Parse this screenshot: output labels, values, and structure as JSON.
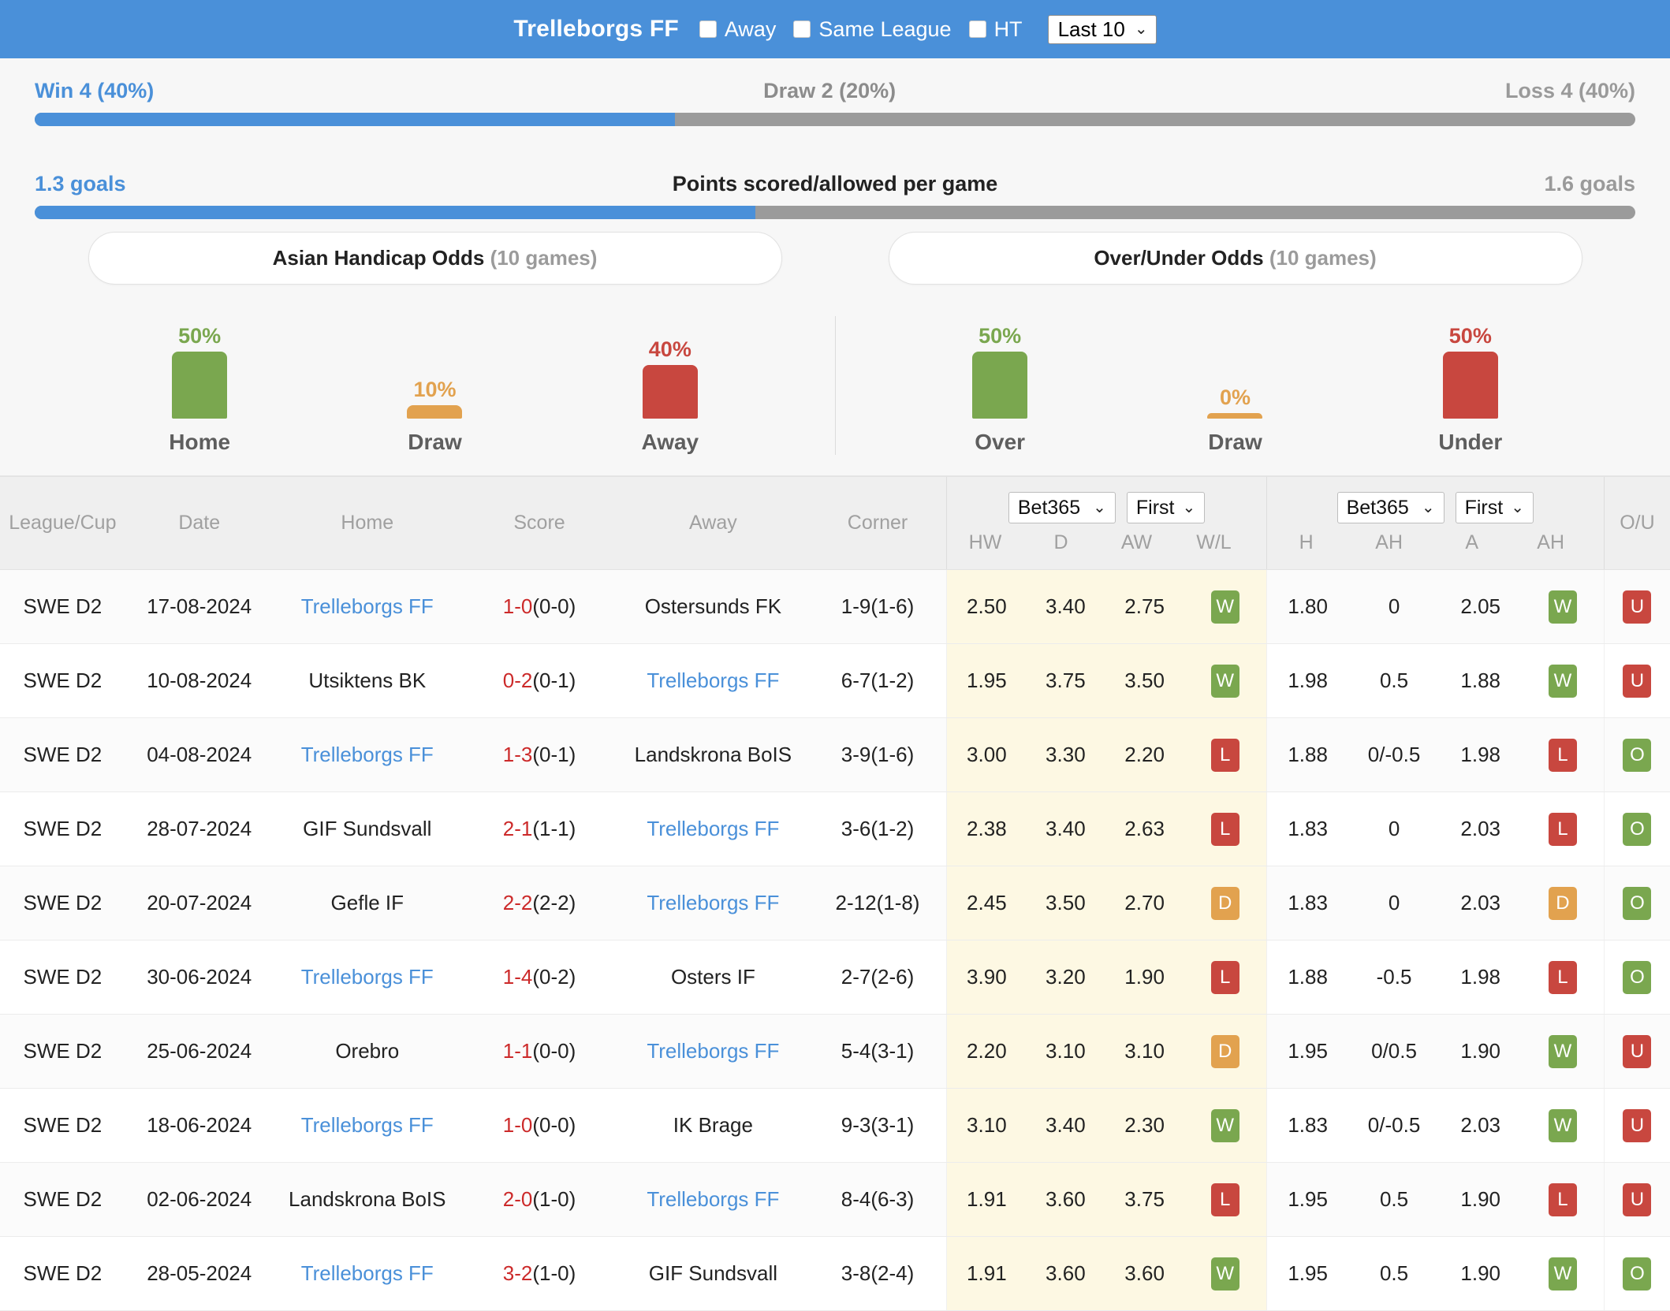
{
  "header": {
    "team": "Trelleborgs FF",
    "checkboxes": [
      {
        "label": "Away",
        "checked": false
      },
      {
        "label": "Same League",
        "checked": false
      },
      {
        "label": "HT",
        "checked": false
      }
    ],
    "range_select": "Last 10"
  },
  "summary": {
    "win_label": "Win 4 (40%)",
    "draw_label": "Draw 2 (20%)",
    "loss_label": "Loss 4 (40%)",
    "wdl_blue_pct": 40,
    "wdl_grey_pct": 60,
    "goals_left": "1.3 goals",
    "goals_title": "Points scored/allowed per game",
    "goals_right": "1.6 goals",
    "goals_blue_pct": 45
  },
  "odds_tabs": {
    "left_title": "Asian Handicap Odds",
    "left_games": "(10 games)",
    "right_title": "Over/Under Odds",
    "right_games": "(10 games)"
  },
  "chart_data": [
    {
      "type": "bar",
      "title": "Asian Handicap Odds (10 games)",
      "categories": [
        "Home",
        "Draw",
        "Away"
      ],
      "values": [
        50,
        10,
        40
      ],
      "labels": [
        "50%",
        "10%",
        "40%"
      ],
      "colors": [
        "#7aa74f",
        "#e2a24f",
        "#c8473f"
      ],
      "ylabel": "",
      "xlabel": "",
      "ylim": [
        0,
        100
      ],
      "grid": false,
      "legend": false
    },
    {
      "type": "bar",
      "title": "Over/Under Odds (10 games)",
      "categories": [
        "Over",
        "Draw",
        "Under"
      ],
      "values": [
        50,
        0,
        50
      ],
      "labels": [
        "50%",
        "0%",
        "50%"
      ],
      "colors": [
        "#7aa74f",
        "#e2a24f",
        "#c8473f"
      ],
      "ylabel": "",
      "xlabel": "",
      "ylim": [
        0,
        100
      ],
      "grid": false,
      "legend": false
    }
  ],
  "table": {
    "headers": {
      "league": "League/Cup",
      "date": "Date",
      "home": "Home",
      "score": "Score",
      "away": "Away",
      "corner": "Corner",
      "ah_bookmaker": "Bet365",
      "ah_period": "First",
      "ou_bookmaker": "Bet365",
      "ou_period": "First",
      "hw": "HW",
      "d": "D",
      "aw": "AW",
      "wl": "W/L",
      "h": "H",
      "ah": "AH",
      "a": "A",
      "ah2": "AH",
      "ou": "O/U"
    },
    "rows": [
      {
        "league": "SWE D2",
        "date": "17-08-2024",
        "home": "Trelleborgs FF",
        "home_hl": true,
        "score": "1-0",
        "ht": "(0-0)",
        "away": "Ostersunds FK",
        "away_hl": false,
        "corner": "1-9(1-6)",
        "hw": "2.50",
        "d": "3.40",
        "aw": "2.75",
        "wl": "W",
        "h": "1.80",
        "ah": "0",
        "a": "2.05",
        "ah2": "W",
        "ou": "U"
      },
      {
        "league": "SWE D2",
        "date": "10-08-2024",
        "home": "Utsiktens BK",
        "home_hl": false,
        "score": "0-2",
        "ht": "(0-1)",
        "away": "Trelleborgs FF",
        "away_hl": true,
        "corner": "6-7(1-2)",
        "hw": "1.95",
        "d": "3.75",
        "aw": "3.50",
        "wl": "W",
        "h": "1.98",
        "ah": "0.5",
        "a": "1.88",
        "ah2": "W",
        "ou": "U"
      },
      {
        "league": "SWE D2",
        "date": "04-08-2024",
        "home": "Trelleborgs FF",
        "home_hl": true,
        "score": "1-3",
        "ht": "(0-1)",
        "away": "Landskrona BoIS",
        "away_hl": false,
        "corner": "3-9(1-6)",
        "hw": "3.00",
        "d": "3.30",
        "aw": "2.20",
        "wl": "L",
        "h": "1.88",
        "ah": "0/-0.5",
        "a": "1.98",
        "ah2": "L",
        "ou": "O"
      },
      {
        "league": "SWE D2",
        "date": "28-07-2024",
        "home": "GIF Sundsvall",
        "home_hl": false,
        "score": "2-1",
        "ht": "(1-1)",
        "away": "Trelleborgs FF",
        "away_hl": true,
        "corner": "3-6(1-2)",
        "hw": "2.38",
        "d": "3.40",
        "aw": "2.63",
        "wl": "L",
        "h": "1.83",
        "ah": "0",
        "a": "2.03",
        "ah2": "L",
        "ou": "O"
      },
      {
        "league": "SWE D2",
        "date": "20-07-2024",
        "home": "Gefle IF",
        "home_hl": false,
        "score": "2-2",
        "ht": "(2-2)",
        "away": "Trelleborgs FF",
        "away_hl": true,
        "corner": "2-12(1-8)",
        "hw": "2.45",
        "d": "3.50",
        "aw": "2.70",
        "wl": "D",
        "h": "1.83",
        "ah": "0",
        "a": "2.03",
        "ah2": "D",
        "ou": "O"
      },
      {
        "league": "SWE D2",
        "date": "30-06-2024",
        "home": "Trelleborgs FF",
        "home_hl": true,
        "score": "1-4",
        "ht": "(0-2)",
        "away": "Osters IF",
        "away_hl": false,
        "corner": "2-7(2-6)",
        "hw": "3.90",
        "d": "3.20",
        "aw": "1.90",
        "wl": "L",
        "h": "1.88",
        "ah": "-0.5",
        "a": "1.98",
        "ah2": "L",
        "ou": "O"
      },
      {
        "league": "SWE D2",
        "date": "25-06-2024",
        "home": "Orebro",
        "home_hl": false,
        "score": "1-1",
        "ht": "(0-0)",
        "away": "Trelleborgs FF",
        "away_hl": true,
        "corner": "5-4(3-1)",
        "hw": "2.20",
        "d": "3.10",
        "aw": "3.10",
        "wl": "D",
        "h": "1.95",
        "ah": "0/0.5",
        "a": "1.90",
        "ah2": "W",
        "ou": "U"
      },
      {
        "league": "SWE D2",
        "date": "18-06-2024",
        "home": "Trelleborgs FF",
        "home_hl": true,
        "score": "1-0",
        "ht": "(0-0)",
        "away": "IK Brage",
        "away_hl": false,
        "corner": "9-3(3-1)",
        "hw": "3.10",
        "d": "3.40",
        "aw": "2.30",
        "wl": "W",
        "h": "1.83",
        "ah": "0/-0.5",
        "a": "2.03",
        "ah2": "W",
        "ou": "U"
      },
      {
        "league": "SWE D2",
        "date": "02-06-2024",
        "home": "Landskrona BoIS",
        "home_hl": false,
        "score": "2-0",
        "ht": "(1-0)",
        "away": "Trelleborgs FF",
        "away_hl": true,
        "corner": "8-4(6-3)",
        "hw": "1.91",
        "d": "3.60",
        "aw": "3.75",
        "wl": "L",
        "h": "1.95",
        "ah": "0.5",
        "a": "1.90",
        "ah2": "L",
        "ou": "U"
      },
      {
        "league": "SWE D2",
        "date": "28-05-2024",
        "home": "Trelleborgs FF",
        "home_hl": true,
        "score": "3-2",
        "ht": "(1-0)",
        "away": "GIF Sundsvall",
        "away_hl": false,
        "corner": "3-8(2-4)",
        "hw": "1.91",
        "d": "3.60",
        "aw": "3.60",
        "wl": "W",
        "h": "1.95",
        "ah": "0.5",
        "a": "1.90",
        "ah2": "W",
        "ou": "O"
      }
    ]
  },
  "colors": {
    "brand_blue": "#4a90d9",
    "grey_bar": "#9b9b9b",
    "green": "#7aa74f",
    "red": "#c8473f",
    "orange": "#e2a24f",
    "score_red": "#cc2a2a",
    "ah_band": "#fdf8e3"
  }
}
